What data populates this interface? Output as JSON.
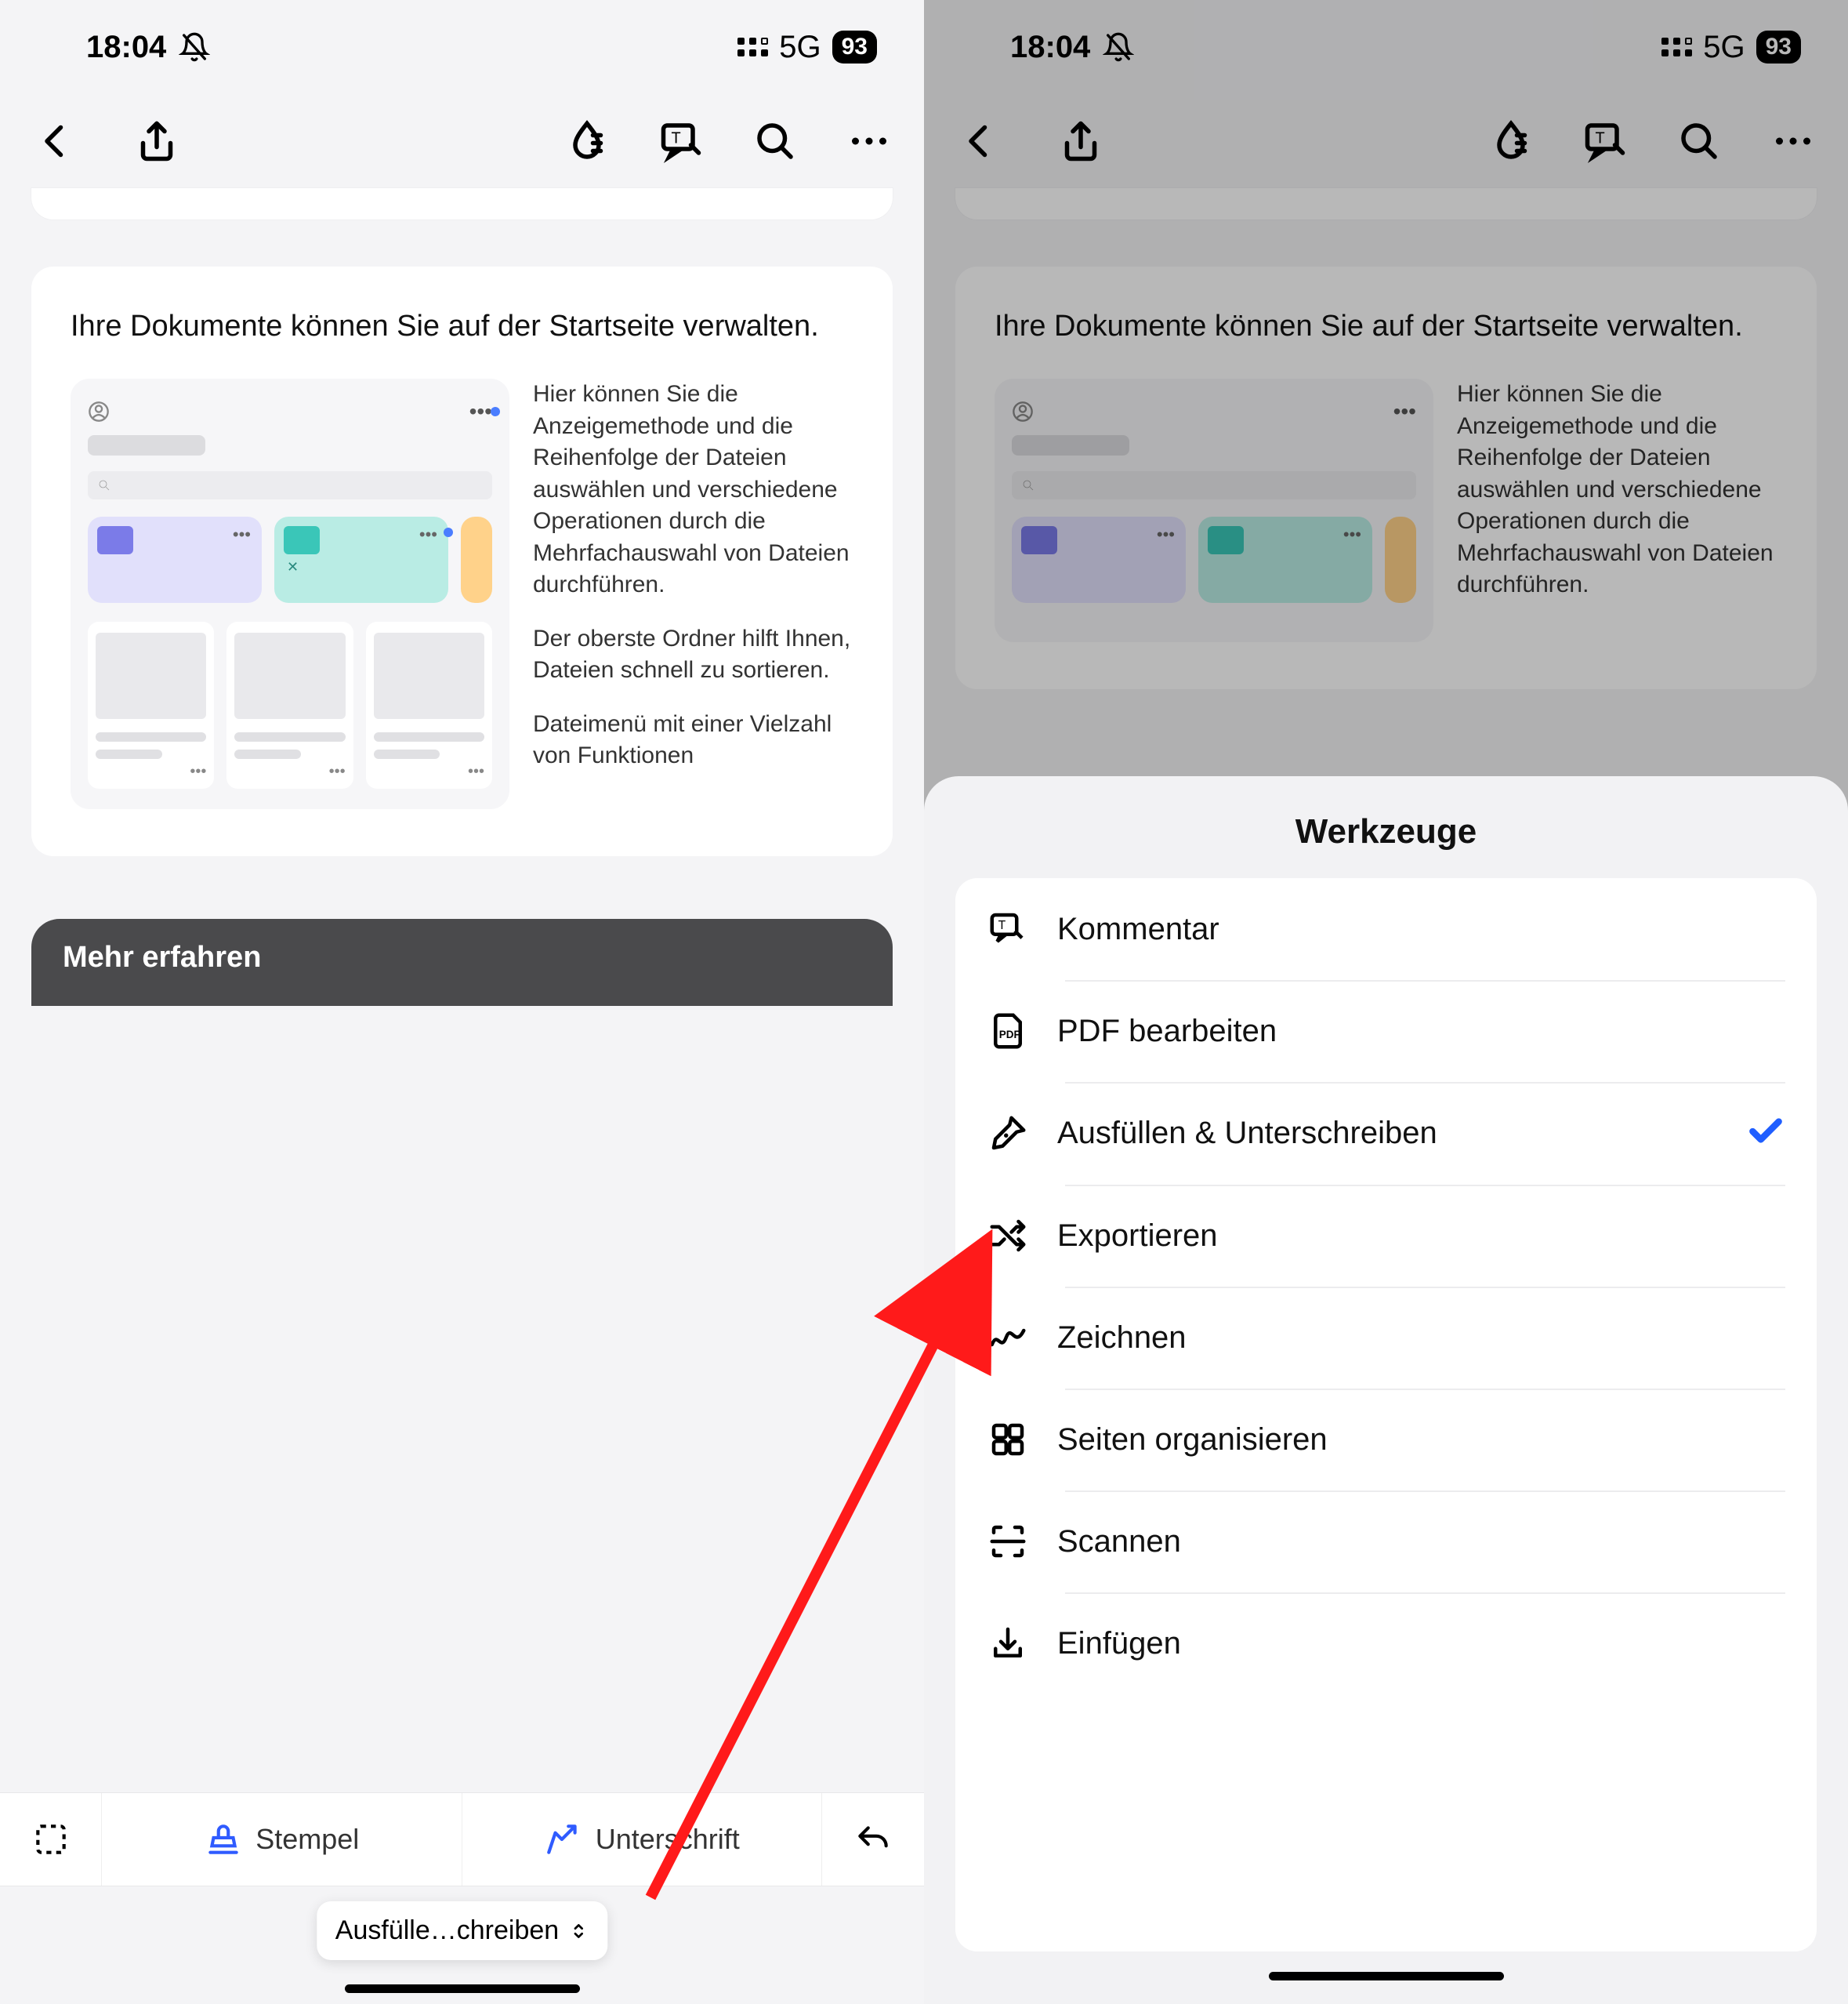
{
  "status": {
    "time": "18:04",
    "network": "5G",
    "battery": "93"
  },
  "help": {
    "title": "Ihre Dokumente können Sie auf der Startseite verwalten.",
    "anno1": "Hier können Sie die Anzeigemethode und die Reihenfolge der Dateien auswählen und verschiedene Operationen durch die Mehrfachauswahl von Dateien durchführen.",
    "anno2": "Der oberste Ordner hilft Ihnen, Dateien schnell zu sortieren.",
    "anno3": "Dateimenü mit einer Vielzahl von Funktionen"
  },
  "more_learn": "Mehr erfahren",
  "bottombar": {
    "stempel": "Stempel",
    "unterschrift": "Unterschrift"
  },
  "mode_pill": "Ausfülle…chreiben",
  "sheet": {
    "title": "Werkzeuge",
    "items": [
      {
        "label": "Kommentar"
      },
      {
        "label": "PDF bearbeiten"
      },
      {
        "label": "Ausfüllen & Unterschreiben",
        "checked": true
      },
      {
        "label": "Exportieren"
      },
      {
        "label": "Zeichnen"
      },
      {
        "label": "Seiten organisieren"
      },
      {
        "label": "Scannen"
      },
      {
        "label": "Einfügen"
      }
    ]
  }
}
